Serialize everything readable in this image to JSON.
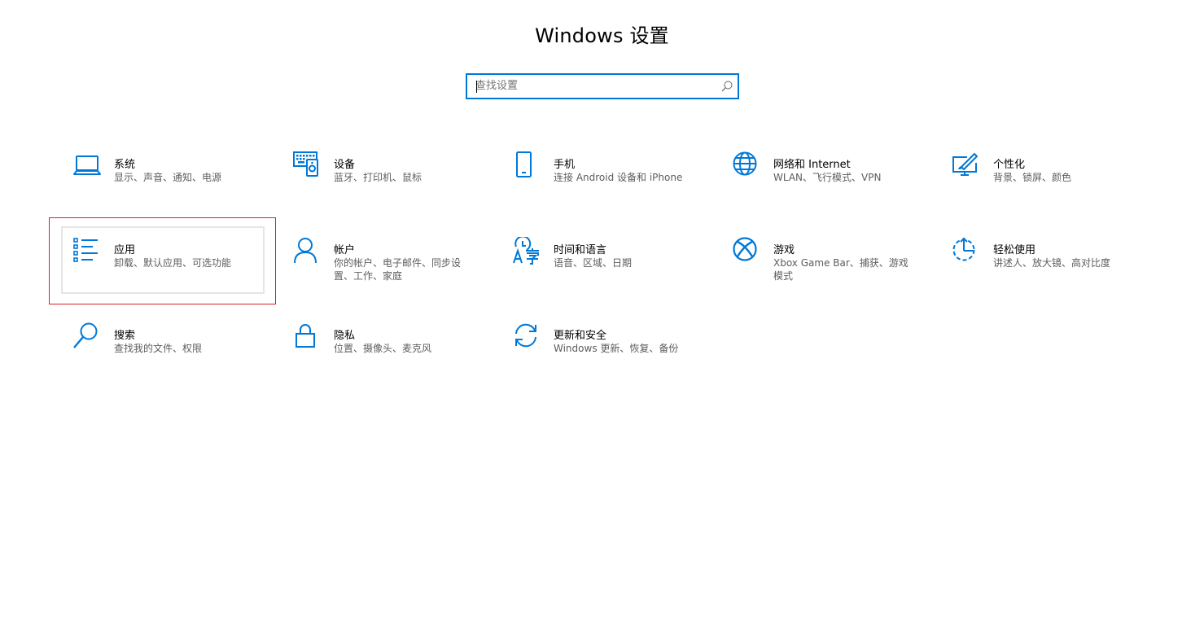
{
  "window": {
    "title": "Windows 设置"
  },
  "search": {
    "placeholder": "查找设置",
    "value": ""
  },
  "colors": {
    "accent": "#0078d7",
    "highlight_border": "#d71f26"
  },
  "categories": [
    {
      "title": "系统",
      "desc": "显示、声音、通知、电源",
      "icon": "laptop-icon"
    },
    {
      "title": "设备",
      "desc": "蓝牙、打印机、鼠标",
      "icon": "devices-icon"
    },
    {
      "title": "手机",
      "desc": "连接 Android 设备和 iPhone",
      "icon": "phone-icon"
    },
    {
      "title": "网络和 Internet",
      "desc": "WLAN、飞行模式、VPN",
      "icon": "globe-icon"
    },
    {
      "title": "个性化",
      "desc": "背景、锁屏、颜色",
      "icon": "personalization-icon"
    },
    {
      "title": "应用",
      "desc": "卸载、默认应用、可选功能",
      "icon": "apps-list-icon"
    },
    {
      "title": "帐户",
      "desc": "你的帐户、电子邮件、同步设置、工作、家庭",
      "icon": "person-icon"
    },
    {
      "title": "时间和语言",
      "desc": "语音、区域、日期",
      "icon": "time-language-icon"
    },
    {
      "title": "游戏",
      "desc": "Xbox Game Bar、捕获、游戏模式",
      "icon": "xbox-icon"
    },
    {
      "title": "轻松使用",
      "desc": "讲述人、放大镜、高对比度",
      "icon": "ease-of-access-icon"
    },
    {
      "title": "搜索",
      "desc": "查找我的文件、权限",
      "icon": "search-icon"
    },
    {
      "title": "隐私",
      "desc": "位置、摄像头、麦克风",
      "icon": "lock-icon"
    },
    {
      "title": "更新和安全",
      "desc": "Windows 更新、恢复、备份",
      "icon": "sync-icon"
    }
  ]
}
